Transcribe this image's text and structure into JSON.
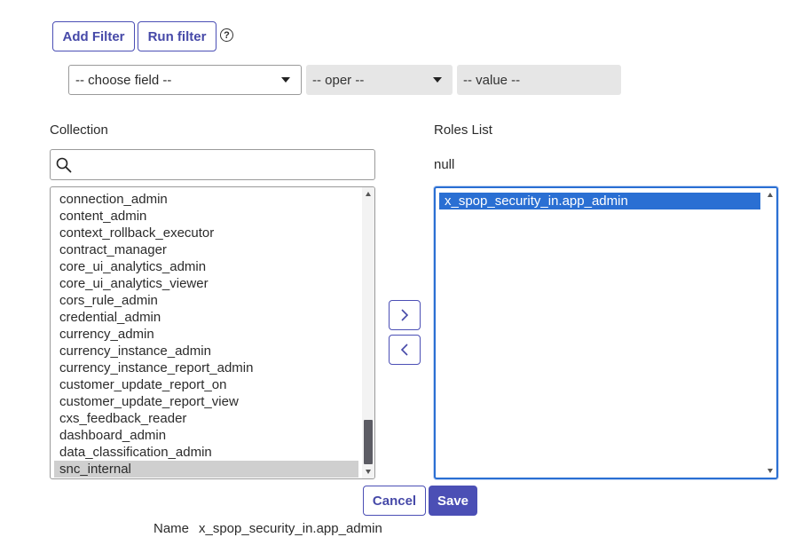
{
  "filter": {
    "add_filter_label": "Add Filter",
    "run_filter_label": "Run filter",
    "help_icon": "?",
    "field_select": "-- choose field --",
    "oper_select": "-- oper --",
    "value_field": "-- value --"
  },
  "collection": {
    "label": "Collection",
    "search_value": "",
    "items": [
      "connection_admin",
      "content_admin",
      "context_rollback_executor",
      "contract_manager",
      "core_ui_analytics_admin",
      "core_ui_analytics_viewer",
      "cors_rule_admin",
      "credential_admin",
      "currency_admin",
      "currency_instance_admin",
      "currency_instance_report_admin",
      "customer_update_report_on",
      "customer_update_report_view",
      "cxs_feedback_reader",
      "dashboard_admin",
      "data_classification_admin",
      "snc_internal"
    ],
    "selected_item": "snc_internal"
  },
  "roles": {
    "label": "Roles List",
    "null_text": "null",
    "items": [
      "x_spop_security_in.app_admin"
    ],
    "selected_item": "x_spop_security_in.app_admin"
  },
  "icons": {
    "search": "search-icon",
    "move_right": "chevron-right-icon",
    "move_left": "chevron-left-icon"
  },
  "actions": {
    "cancel_label": "Cancel",
    "save_label": "Save"
  },
  "footer": {
    "name_label": "Name",
    "name_value": "x_spop_security_in.app_admin"
  },
  "colors": {
    "accent": "#4b4fb5",
    "selection_blue": "#2a6fd3",
    "selection_gray": "#cfcfcf",
    "disabled_field": "#e6e6e6"
  }
}
